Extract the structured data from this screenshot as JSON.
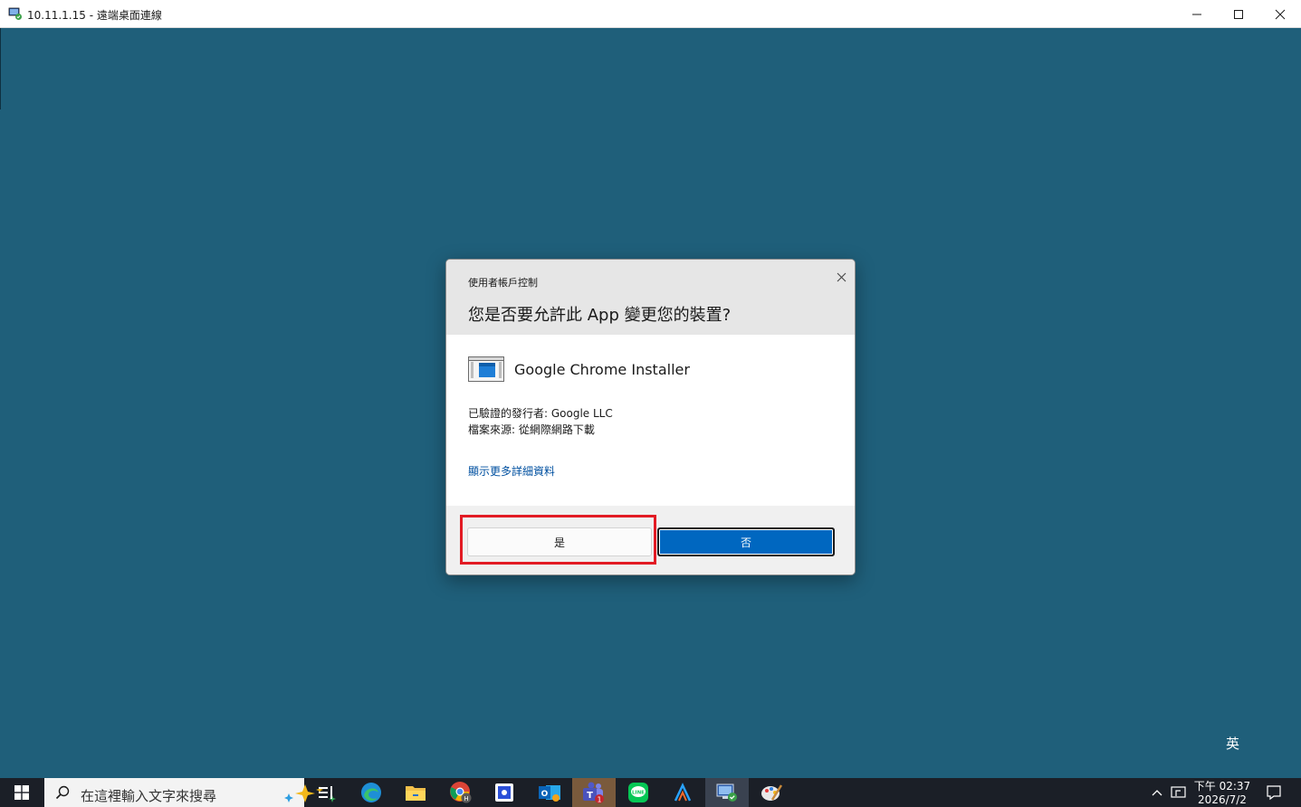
{
  "window": {
    "title": "10.11.1.15 - 遠端桌面連線",
    "minimize_label": "",
    "maximize_label": "",
    "close_label": ""
  },
  "uac": {
    "caption": "使用者帳戶控制",
    "question": "您是否要允許此 App 變更您的裝置?",
    "app_name": "Google Chrome Installer",
    "publisher": "已驗證的發行者: Google LLC",
    "file_origin": "檔案來源: 從網際網路下載",
    "details_link": "顯示更多詳細資料",
    "yes_label": "是",
    "no_label": "否",
    "highlight_color": "#e21b24",
    "primary_color": "#0067c0"
  },
  "desktop": {
    "background": "#1f5f7a",
    "ime_indicator": "英"
  },
  "taskbar": {
    "search_placeholder": "在這裡輸入文字來搜尋",
    "icons": [
      "windows-start-icon",
      "search-icon",
      "copilot-sparkle-icon",
      "task-view-icon",
      "edge-icon",
      "file-explorer-icon",
      "chrome-icon",
      "snipping-icon",
      "outlook-icon",
      "teams-icon",
      "line-icon",
      "app-a-icon",
      "remote-desktop-icon",
      "paint-icon"
    ],
    "teams_badge": "1",
    "clock_period_time": "下午 02:37",
    "clock_date": "2026/7/2"
  }
}
